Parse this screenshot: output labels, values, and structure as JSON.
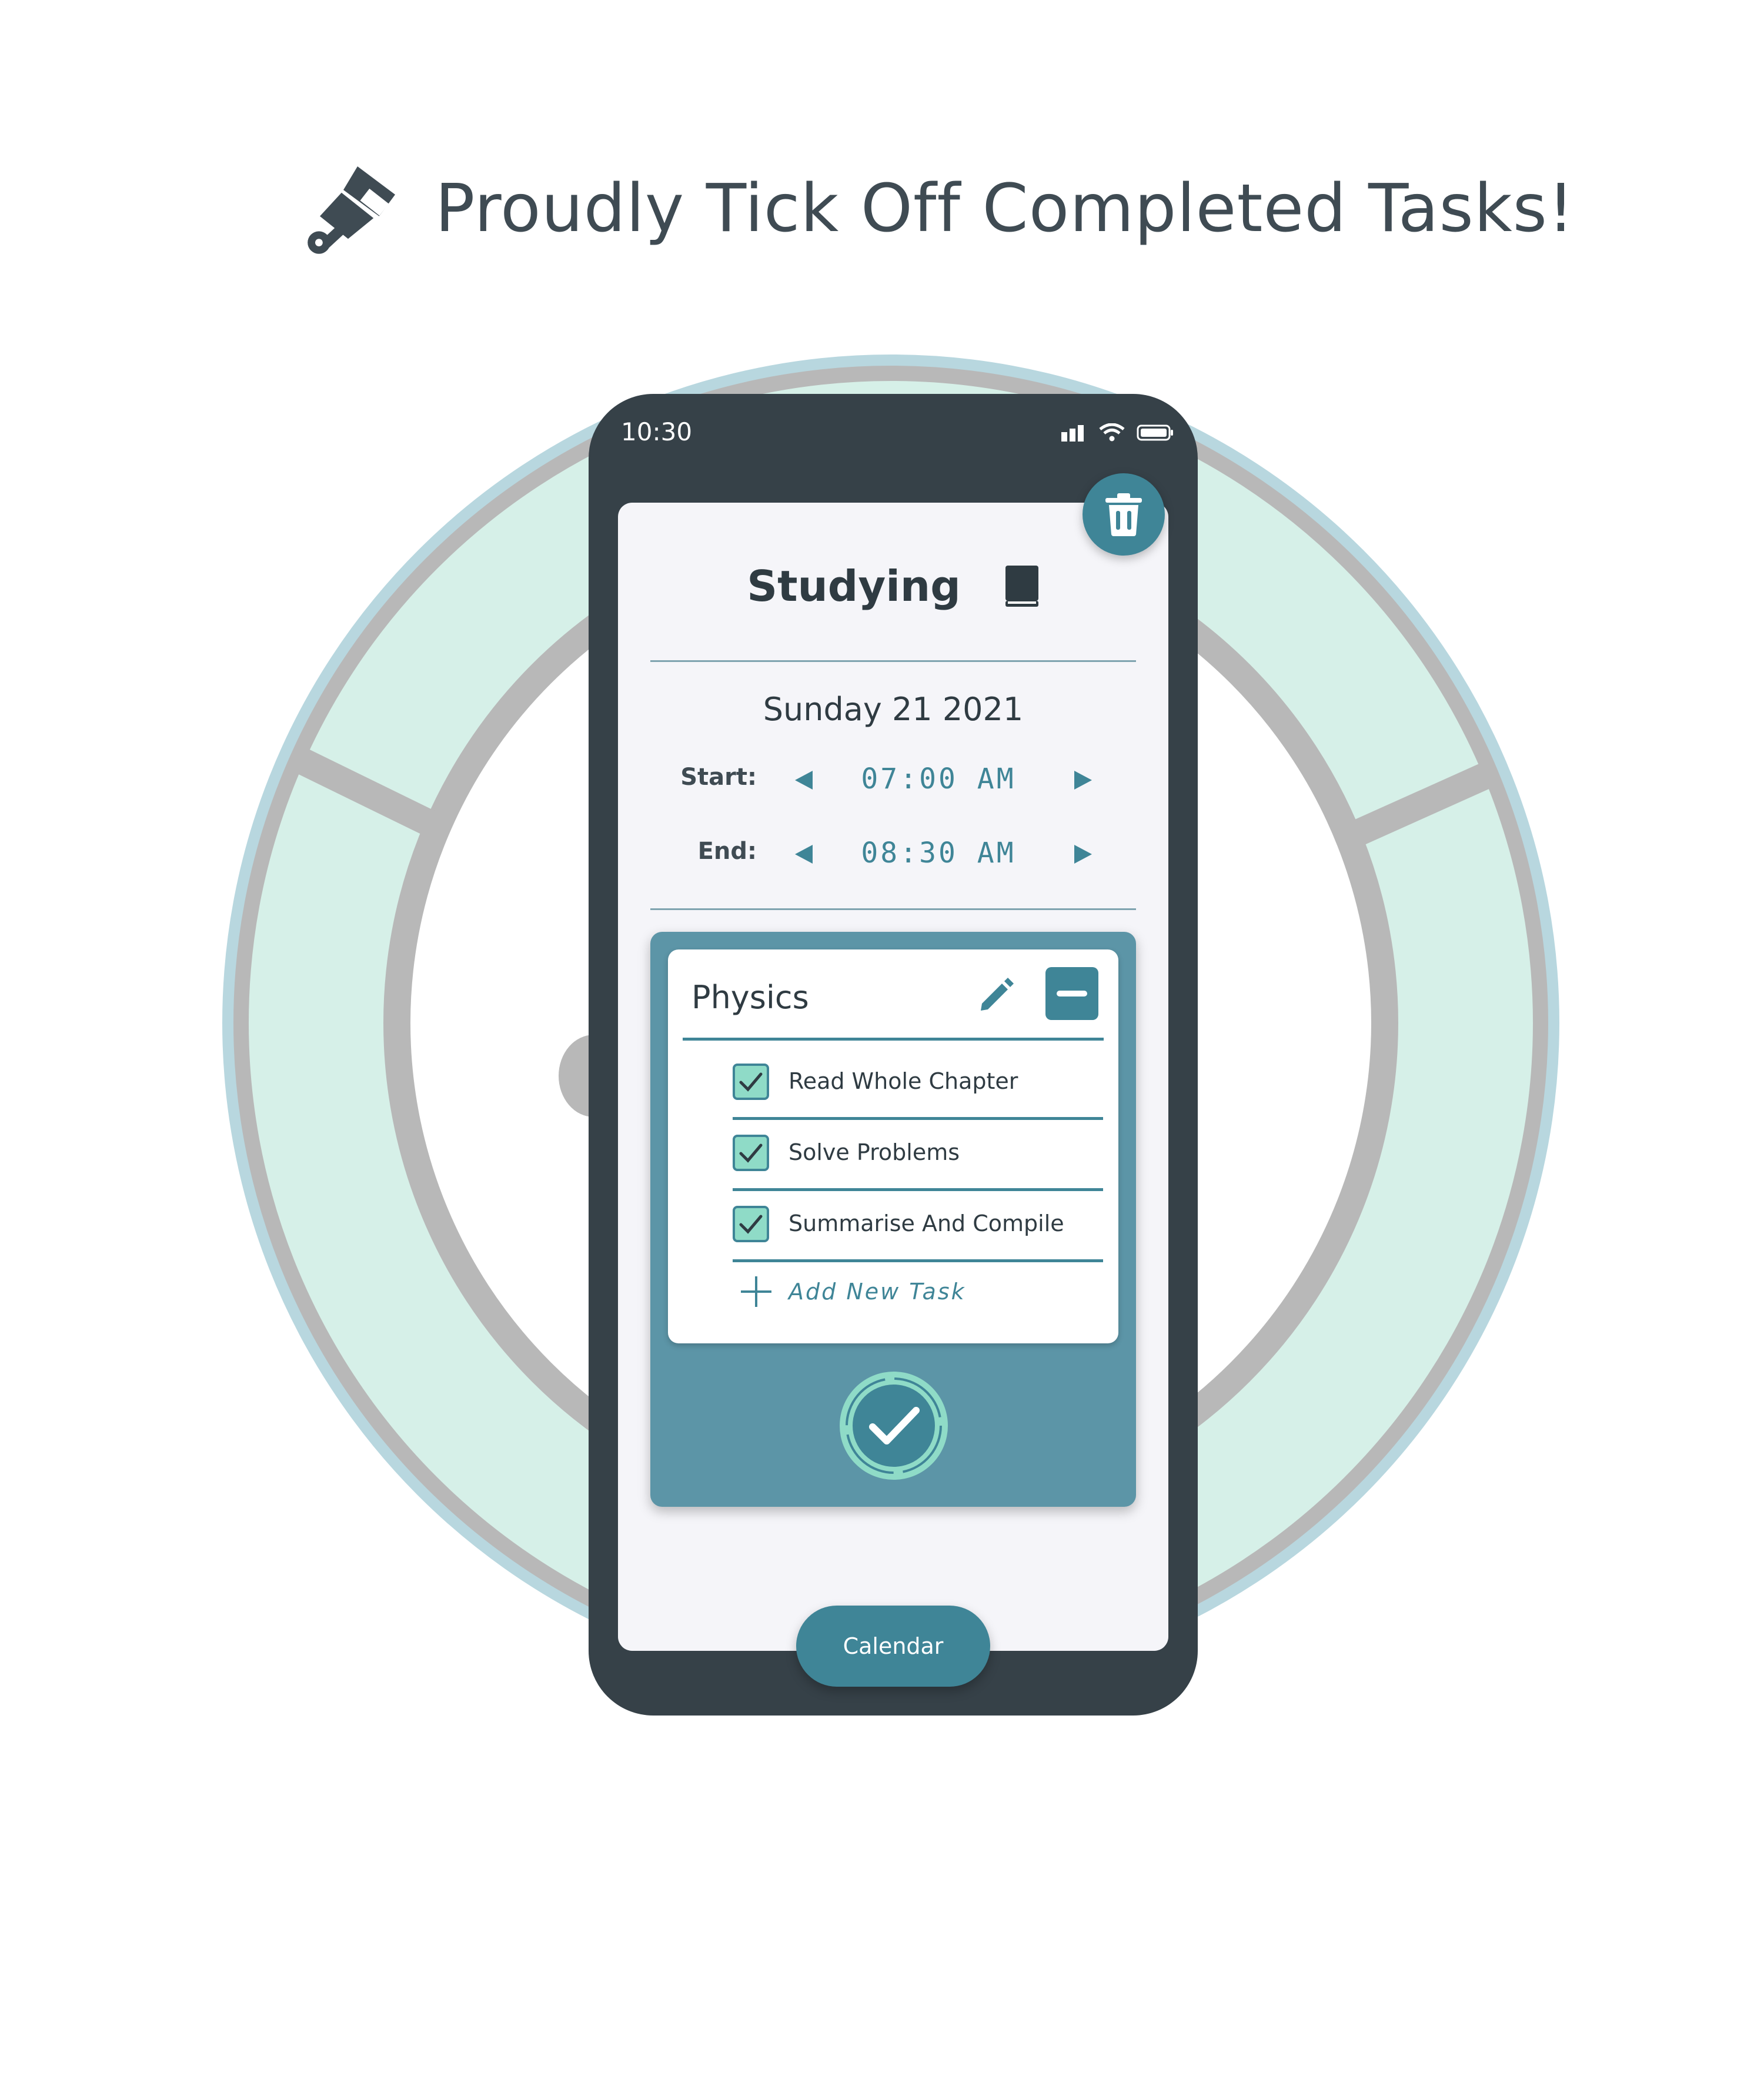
{
  "heading": {
    "text": "Proudly Tick Off Completed Tasks!",
    "icon": "paint-brush-icon"
  },
  "status_bar": {
    "time": "10:30"
  },
  "screen": {
    "title": "Studying",
    "title_icon": "book-icon",
    "date": "Sunday 21 2021",
    "start": {
      "label": "Start:",
      "value": "07:00 AM"
    },
    "end": {
      "label": "End:",
      "value": "08:30 AM"
    },
    "task_group": {
      "title": "Physics",
      "tasks": [
        {
          "label": "Read Whole Chapter",
          "checked": true
        },
        {
          "label": "Solve Problems",
          "checked": true
        },
        {
          "label": "Summarise And Compile",
          "checked": true
        }
      ],
      "add_task_label": "Add New Task"
    },
    "calendar_button": "Calendar"
  },
  "colors": {
    "accent": "#3f8597",
    "panel": "#5c95a7",
    "mint": "#8fdbc7",
    "phone_body": "#364148",
    "screen_bg": "#f5f5f9"
  }
}
